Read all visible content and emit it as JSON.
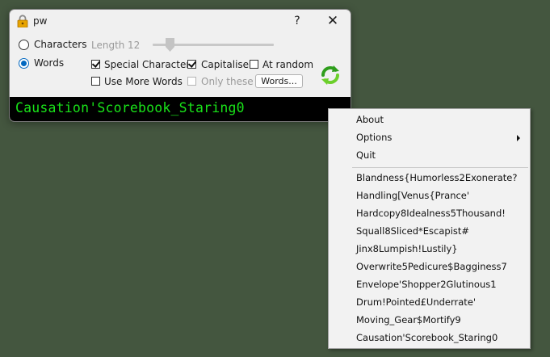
{
  "window": {
    "title": "pw",
    "help_label": "?",
    "close_label": "✕"
  },
  "options": {
    "characters_label": "Characters",
    "words_label": "Words",
    "mode_selected": "Words",
    "length_label": "Length",
    "length_value": "12",
    "special_characters": {
      "label": "Special Characters",
      "checked": true
    },
    "capitalise": {
      "label": "Capitalise",
      "checked": true
    },
    "at_random": {
      "label": "At random",
      "checked": false
    },
    "use_more_words": {
      "label": "Use More Words",
      "checked": false
    },
    "only_these": {
      "label": "Only these",
      "checked": false,
      "disabled": true
    },
    "words_button_label": "Words..."
  },
  "output": {
    "password": "Causation'Scorebook_Staring0",
    "text_color": "#19e319",
    "background": "#000000"
  },
  "menu": {
    "about_label": "About",
    "options_label": "Options",
    "quit_label": "Quit",
    "history": [
      "Blandness{Humorless2Exonerate?",
      "Handling[Venus{Prance'",
      "Hardcopy8Idealness5Thousand!",
      "Squall8Sliced*Escapist#",
      "Jinx8Lumpish!Lustily}",
      "Overwrite5Pedicure$Bagginess7",
      "Envelope'Shopper2Glutinous1",
      "Drum!Pointed£Underrate'",
      "Moving_Gear$Mortify9",
      "Causation'Scorebook_Staring0"
    ]
  },
  "icons": {
    "app": "lock-icon",
    "refresh": "refresh-icon"
  }
}
